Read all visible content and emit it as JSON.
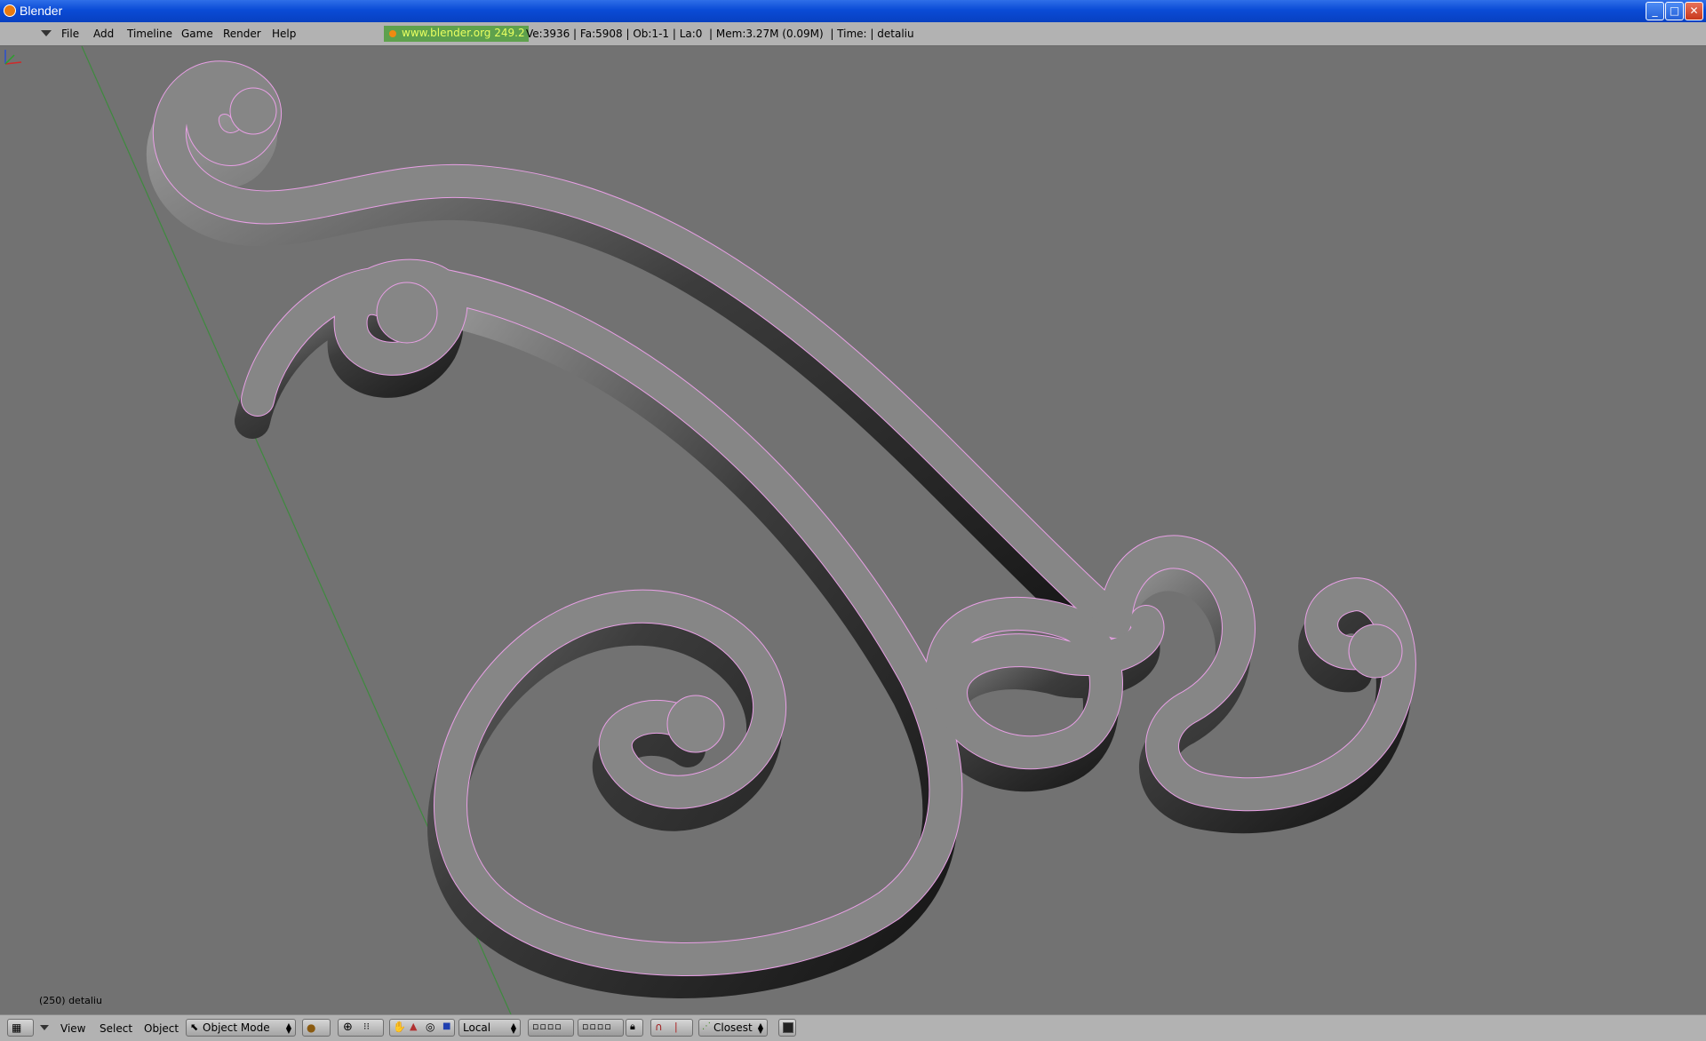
{
  "window": {
    "title": "Blender",
    "minimize": "_",
    "maximize": "□",
    "close": "✕"
  },
  "menubar": {
    "items": [
      "File",
      "Add",
      "Timeline",
      "Game",
      "Render",
      "Help"
    ],
    "link": "www.blender.org 249.2",
    "stats": "Ve:3936 | Fa:5908 | Ob:1-1 | La:0  | Mem:3.27M (0.09M)  | Time: | detaliu"
  },
  "viewport": {
    "frame_label": "(250) detaliu",
    "object": "ornamental scroll mesh",
    "background_color": "#727272",
    "surface_color": "#868686",
    "outline_color": "#e9a0e6"
  },
  "bottombar": {
    "view": "View",
    "select": "Select",
    "object": "Object",
    "mode": "Object Mode",
    "pivot": "Local",
    "snap": "Closest"
  },
  "icons": [
    "blender-logo-icon",
    "grid-icon",
    "viewport-shading-icon",
    "pivot-icon",
    "hand-icon",
    "vertex-mode-icon",
    "edge-mode-icon",
    "face-mode-icon",
    "layers-icon",
    "lock-icon",
    "magnet-icon",
    "render-icon"
  ]
}
